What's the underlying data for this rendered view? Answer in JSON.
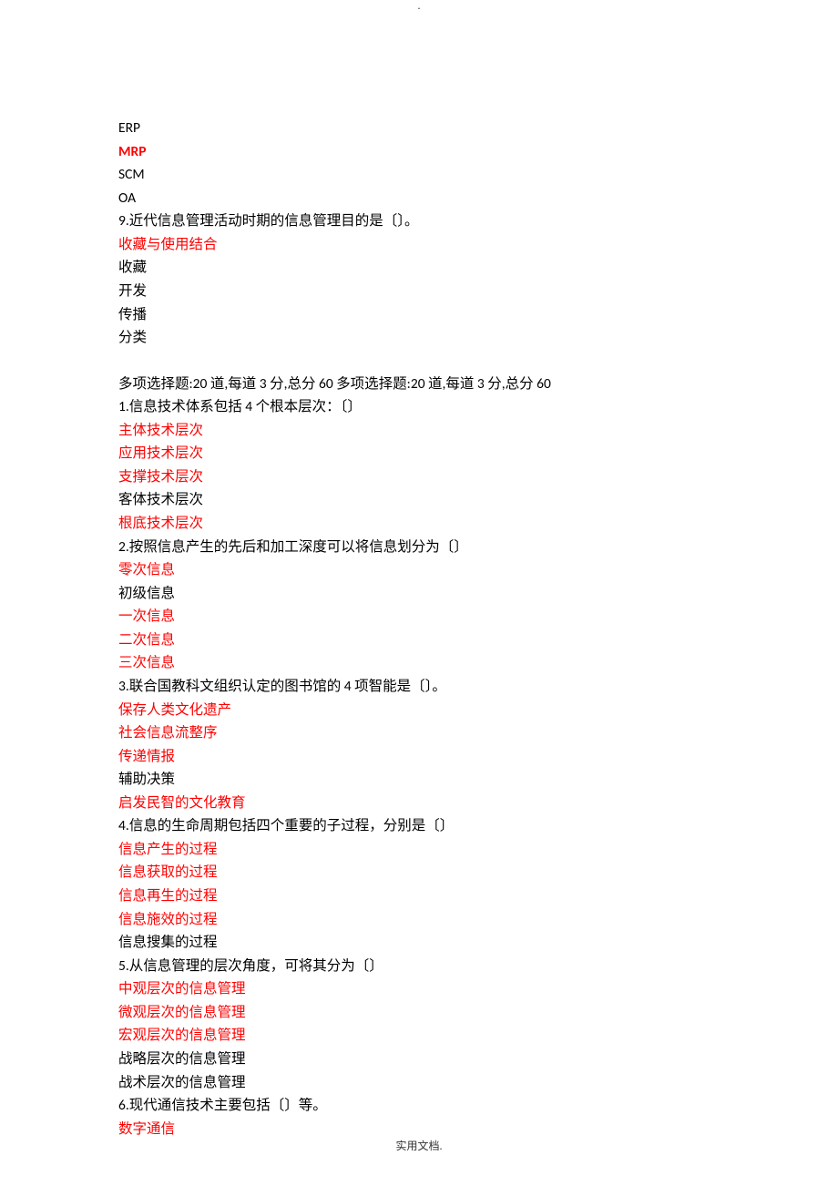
{
  "header_dot": ".",
  "footer": "实用文档.",
  "lines": [
    {
      "text": "ERP",
      "red": false,
      "bold": false
    },
    {
      "text": "MRP",
      "red": true,
      "bold": true
    },
    {
      "text": "SCM",
      "red": false,
      "bold": false
    },
    {
      "text": "OA",
      "red": false,
      "bold": false
    },
    {
      "text": "9.近代信息管理活动时期的信息管理目的是〔〕。",
      "red": false,
      "bold": false
    },
    {
      "text": "收藏与使用结合",
      "red": true,
      "bold": false
    },
    {
      "text": "收藏",
      "red": false,
      "bold": false
    },
    {
      "text": "开发",
      "red": false,
      "bold": false
    },
    {
      "text": "传播",
      "red": false,
      "bold": false
    },
    {
      "text": "分类",
      "red": false,
      "bold": false
    },
    {
      "spacer": true
    },
    {
      "text": "多项选择题:20 道,每道 3 分,总分 60 多项选择题:20 道,每道 3 分,总分 60",
      "red": false,
      "bold": false
    },
    {
      "text": "1.信息技术体系包括 4 个根本层次：〔〕",
      "red": false,
      "bold": false
    },
    {
      "text": "主体技术层次",
      "red": true,
      "bold": false
    },
    {
      "text": "应用技术层次",
      "red": true,
      "bold": false
    },
    {
      "text": "支撑技术层次",
      "red": true,
      "bold": false
    },
    {
      "text": "客体技术层次",
      "red": false,
      "bold": false
    },
    {
      "text": "根底技术层次",
      "red": true,
      "bold": false
    },
    {
      "text": "2.按照信息产生的先后和加工深度可以将信息划分为〔〕",
      "red": false,
      "bold": false
    },
    {
      "text": "零次信息",
      "red": true,
      "bold": false
    },
    {
      "text": "初级信息",
      "red": false,
      "bold": false
    },
    {
      "text": "一次信息",
      "red": true,
      "bold": false
    },
    {
      "text": "二次信息",
      "red": true,
      "bold": false
    },
    {
      "text": "三次信息",
      "red": true,
      "bold": false
    },
    {
      "text": "3.联合国教科文组织认定的图书馆的 4 项智能是〔〕。",
      "red": false,
      "bold": false
    },
    {
      "text": "保存人类文化遗产",
      "red": true,
      "bold": false
    },
    {
      "text": "社会信息流整序",
      "red": true,
      "bold": false
    },
    {
      "text": "传递情报",
      "red": true,
      "bold": false
    },
    {
      "text": "辅助决策",
      "red": false,
      "bold": false
    },
    {
      "text": "启发民智的文化教育",
      "red": true,
      "bold": false
    },
    {
      "text": "4.信息的生命周期包括四个重要的子过程，分别是〔〕",
      "red": false,
      "bold": false
    },
    {
      "text": "信息产生的过程",
      "red": true,
      "bold": false
    },
    {
      "text": "信息获取的过程",
      "red": true,
      "bold": false
    },
    {
      "text": "信息再生的过程",
      "red": true,
      "bold": false
    },
    {
      "text": "信息施效的过程",
      "red": true,
      "bold": false
    },
    {
      "text": "信息搜集的过程",
      "red": false,
      "bold": false
    },
    {
      "text": "5.从信息管理的层次角度，可将其分为〔〕",
      "red": false,
      "bold": false
    },
    {
      "text": "中观层次的信息管理",
      "red": true,
      "bold": false
    },
    {
      "text": "微观层次的信息管理",
      "red": true,
      "bold": false
    },
    {
      "text": "宏观层次的信息管理",
      "red": true,
      "bold": false
    },
    {
      "text": "战略层次的信息管理",
      "red": false,
      "bold": false
    },
    {
      "text": "战术层次的信息管理",
      "red": false,
      "bold": false
    },
    {
      "text": "6.现代通信技术主要包括〔〕等。",
      "red": false,
      "bold": false
    },
    {
      "text": "数字通信",
      "red": true,
      "bold": false
    }
  ]
}
